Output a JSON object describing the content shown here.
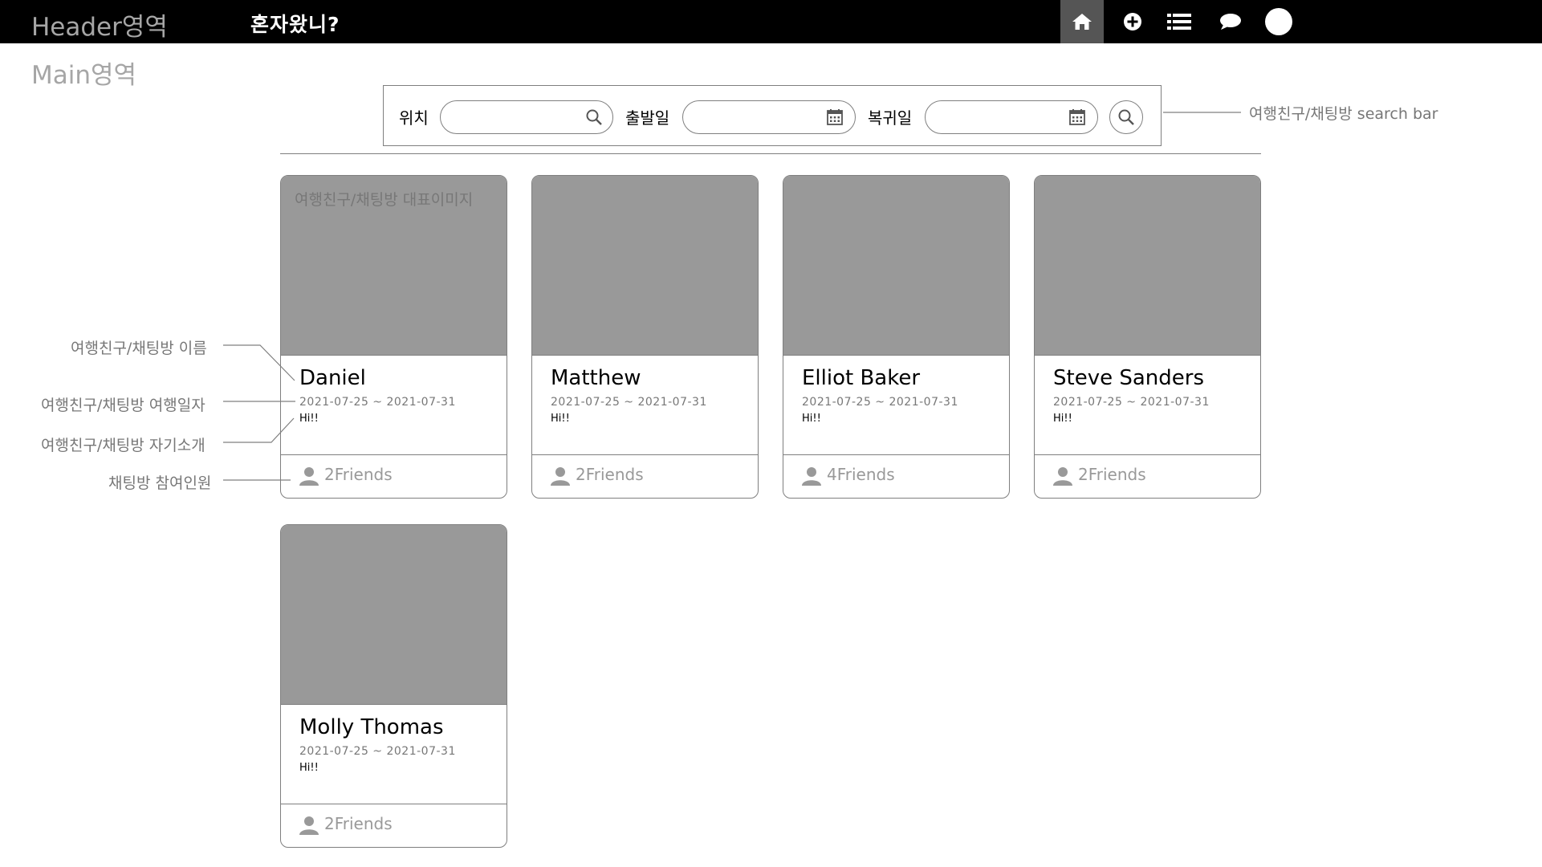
{
  "header": {
    "area_label": "Header영역",
    "title": "혼자왔니?",
    "nav": [
      {
        "name": "home",
        "icon": "home-icon"
      },
      {
        "name": "add",
        "icon": "plus-circle-icon"
      },
      {
        "name": "list",
        "icon": "list-icon"
      },
      {
        "name": "chat",
        "icon": "chat-bubble-icon"
      },
      {
        "name": "profile",
        "icon": "avatar-circle-icon"
      }
    ]
  },
  "main": {
    "area_label": "Main영역"
  },
  "search": {
    "location_label": "위치",
    "location_value": "",
    "departure_label": "출발일",
    "departure_value": "",
    "return_label": "복귀일",
    "return_value": "",
    "icons": [
      "search-icon",
      "calendar-icon",
      "calendar-icon",
      "search-icon"
    ]
  },
  "cards": [
    {
      "image_caption": "여행친구/채팅방 대표이미지",
      "name": "Daniel",
      "dates": "2021-07-25 ~ 2021-07-31",
      "intro": "Hi!!",
      "people": "2Friends"
    },
    {
      "image_caption": "",
      "name": "Matthew",
      "dates": "2021-07-25 ~ 2021-07-31",
      "intro": "Hi!!",
      "people": "2Friends"
    },
    {
      "image_caption": "",
      "name": "Elliot Baker",
      "dates": "2021-07-25 ~ 2021-07-31",
      "intro": "Hi!!",
      "people": "4Friends"
    },
    {
      "image_caption": "",
      "name": "Steve Sanders",
      "dates": "2021-07-25 ~ 2021-07-31",
      "intro": "Hi!!",
      "people": "2Friends"
    },
    {
      "image_caption": "",
      "name": "Molly Thomas",
      "dates": "2021-07-25 ~ 2021-07-31",
      "intro": "Hi!!",
      "people": "2Friends"
    }
  ],
  "annotations": {
    "search_bar": "여행친구/채팅방 search bar",
    "name": "여행친구/채팅방 이름",
    "dates": "여행친구/채팅방 여행일자",
    "intro": "여행친구/채팅방 자기소개",
    "people": "채팅방 참여인원"
  },
  "colors": {
    "header_bg": "#000000",
    "active_nav_bg": "#555555",
    "image_placeholder": "#999999",
    "border": "#7f7f7f",
    "annotation_text": "#777777"
  }
}
